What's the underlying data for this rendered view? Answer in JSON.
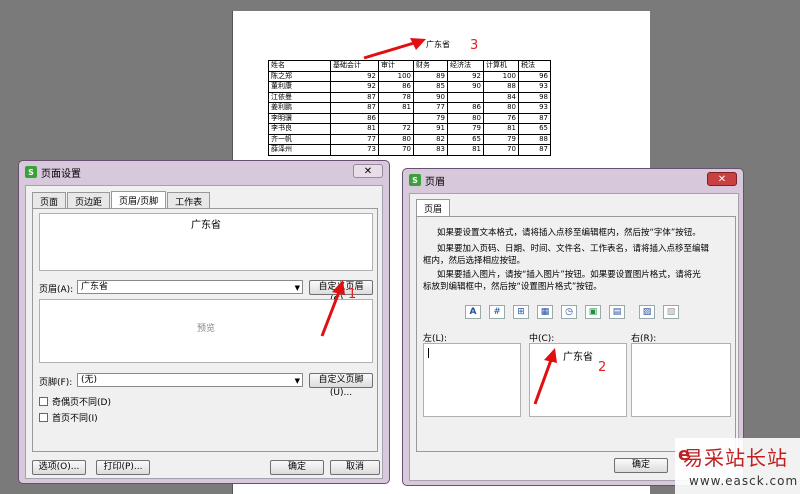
{
  "sheet": {
    "header_text": "广东省",
    "columns": [
      "姓名",
      "基础会计",
      "审计",
      "财务",
      "经济法",
      "计算机",
      "税法"
    ],
    "rows": [
      [
        "陈之郑",
        "92",
        "100",
        "89",
        "92",
        "100",
        "96"
      ],
      [
        "董利康",
        "92",
        "86",
        "85",
        "90",
        "88",
        "93"
      ],
      [
        "江依曼",
        "87",
        "78",
        "90",
        "",
        "84",
        "98"
      ],
      [
        "姜利鹏",
        "87",
        "81",
        "77",
        "86",
        "80",
        "93"
      ],
      [
        "李明骥",
        "86",
        "",
        "79",
        "80",
        "76",
        "87"
      ],
      [
        "李书良",
        "81",
        "72",
        "91",
        "79",
        "81",
        "65"
      ],
      [
        "齐一帆",
        "77",
        "80",
        "82",
        "65",
        "79",
        "88"
      ],
      [
        "薛泽州",
        "73",
        "70",
        "83",
        "81",
        "70",
        "87"
      ]
    ]
  },
  "annotations": {
    "n1": "1",
    "n2": "2",
    "n3": "3"
  },
  "page_setup": {
    "title": "页面设置",
    "tabs": [
      "页面",
      "页边距",
      "页眉/页脚",
      "工作表"
    ],
    "active_tab": 2,
    "header_preview": "广东省",
    "header_label": "页眉(A):",
    "header_value": "广东省",
    "custom_header_button": "自定义页眉(C)...",
    "footer_preview": "预览",
    "footer_label": "页脚(F):",
    "footer_value": "(无)",
    "custom_footer_button": "自定义页脚(U)...",
    "odd_even_label": "奇偶页不同(D)",
    "first_page_label": "首页不同(I)",
    "options_button": "选项(O)...",
    "print_button": "打印(P)...",
    "ok_button": "确定",
    "cancel_button": "取消"
  },
  "header_dialog": {
    "title": "页眉",
    "tab": "页眉",
    "instr1": "如果要设置文本格式，请将插入点移至编辑框内，然后按“字体”按钮。",
    "instr2a": "如果要加入页码、日期、时间、文件名、工作表名，请将插入点移至编辑",
    "instr2b": "框内，然后选择相应按钮。",
    "instr3a": "如果要插入图片，请按“插入图片”按钮。如果要设置图片格式，请将光",
    "instr3b": "标放到编辑框中，然后按“设置图片格式”按钮。",
    "left_label": "左(L):",
    "center_label": "中(C):",
    "right_label": "右(R):",
    "center_value": "广东省",
    "ok_button": "确定"
  },
  "watermark": {
    "name": "易采站长站",
    "url": "www.easck.com"
  }
}
